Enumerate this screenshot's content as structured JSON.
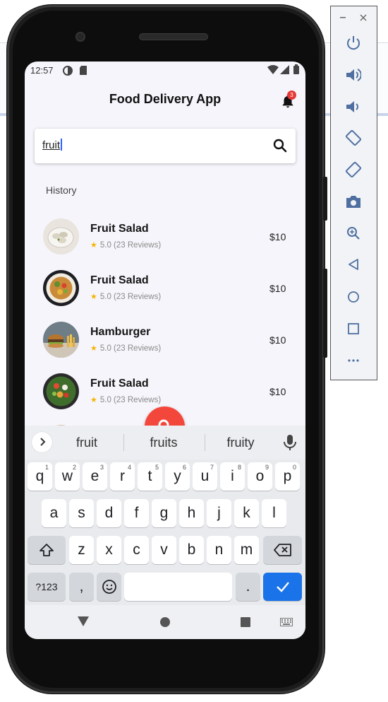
{
  "status_bar": {
    "time": "12:57"
  },
  "app": {
    "title": "Food Delivery App",
    "notification_count": "3"
  },
  "search": {
    "value": "fruit"
  },
  "history_label": "History",
  "items": [
    {
      "name": "Fruit Salad",
      "rating": "5.0 (23 Reviews)",
      "price": "$10",
      "image": "dumpling-bowl"
    },
    {
      "name": "Fruit Salad",
      "rating": "5.0 (23 Reviews)",
      "price": "$10",
      "image": "salad-plate"
    },
    {
      "name": "Hamburger",
      "rating": "5.0 (23 Reviews)",
      "price": "$10",
      "image": "burger-fries"
    },
    {
      "name": "Fruit Salad",
      "rating": "5.0 (23 Reviews)",
      "price": "$10",
      "image": "salad-bowl"
    }
  ],
  "keyboard": {
    "suggestions": [
      "fruit",
      "fruits",
      "fruity"
    ],
    "row1": [
      [
        "q",
        "1"
      ],
      [
        "w",
        "2"
      ],
      [
        "e",
        "3"
      ],
      [
        "r",
        "4"
      ],
      [
        "t",
        "5"
      ],
      [
        "y",
        "6"
      ],
      [
        "u",
        "7"
      ],
      [
        "i",
        "8"
      ],
      [
        "o",
        "9"
      ],
      [
        "p",
        "0"
      ]
    ],
    "row2": [
      "a",
      "s",
      "d",
      "f",
      "g",
      "h",
      "j",
      "k",
      "l"
    ],
    "row3": [
      "z",
      "x",
      "c",
      "v",
      "b",
      "n",
      "m"
    ],
    "symbols_key": "?123",
    "comma_key": ",",
    "period_key": "."
  },
  "colors": {
    "accent": "#f4473b",
    "badge": "#e53935",
    "enter": "#1a73e8",
    "star": "#f5b400"
  },
  "emulator_toolbar": {
    "icons": [
      "minimize-icon",
      "close-icon",
      "power-icon",
      "volume-up-icon",
      "volume-down-icon",
      "rotate-left-icon",
      "rotate-right-icon",
      "camera-icon",
      "zoom-icon",
      "back-icon",
      "home-icon",
      "overview-icon",
      "more-icon"
    ]
  }
}
